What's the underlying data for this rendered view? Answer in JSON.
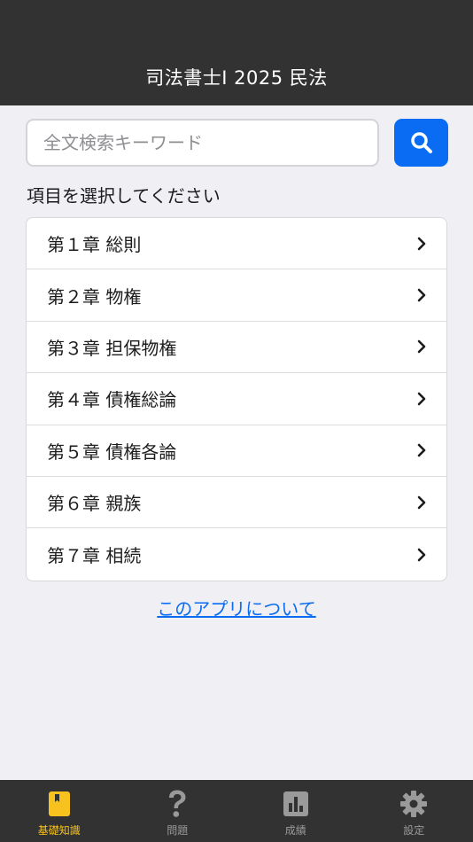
{
  "header": {
    "title": "司法書士I 2025 民法"
  },
  "search": {
    "placeholder": "全文検索キーワード",
    "value": ""
  },
  "prompt": "項目を選択してください",
  "chapters": [
    {
      "label": "第１章 総則"
    },
    {
      "label": "第２章 物権"
    },
    {
      "label": "第３章 担保物権"
    },
    {
      "label": "第４章 債権総論"
    },
    {
      "label": "第５章 債権各論"
    },
    {
      "label": "第６章 親族"
    },
    {
      "label": "第７章 相続"
    }
  ],
  "about_link": "このアプリについて",
  "tabs": [
    {
      "label": "基礎知識",
      "icon": "bookmark-book-icon",
      "active": true
    },
    {
      "label": "問題",
      "icon": "question-mark-icon",
      "active": false
    },
    {
      "label": "成績",
      "icon": "bar-chart-icon",
      "active": false
    },
    {
      "label": "設定",
      "icon": "gear-icon",
      "active": false
    }
  ],
  "colors": {
    "header_bg": "#323232",
    "accent": "#0a6cf2",
    "active_tab": "#f7c21d",
    "inactive_tab": "#9a9a9a",
    "background": "#efeff4"
  }
}
